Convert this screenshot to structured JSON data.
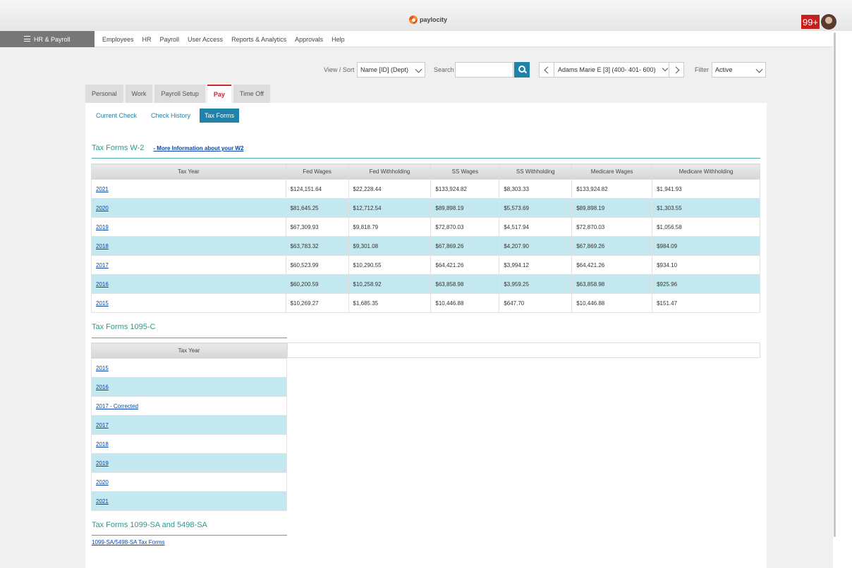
{
  "header": {
    "logo_text": "paylocity",
    "notification_count": "99+"
  },
  "nav": {
    "module_label": "HR & Payroll",
    "items": [
      "Employees",
      "HR",
      "Payroll",
      "User Access",
      "Reports & Analytics",
      "Approvals",
      "Help"
    ]
  },
  "controls": {
    "view_sort_label": "View / Sort",
    "view_sort_value": "Name [ID] (Dept)",
    "search_label": "Search",
    "search_value": "",
    "employee_value": "Adams Marie E [3] (400- 401- 600)",
    "filter_label": "Filter",
    "filter_value": "Active"
  },
  "tabs": [
    "Personal",
    "Work",
    "Payroll Setup",
    "Pay",
    "Time Off"
  ],
  "active_tab": "Pay",
  "subtabs": [
    "Current Check",
    "Check History",
    "Tax Forms"
  ],
  "active_subtab": "Tax Forms",
  "w2": {
    "title": "Tax Forms W-2",
    "more_link": "- More Information about your W2",
    "columns": [
      "Tax Year",
      "Fed Wages",
      "Fed Withholding",
      "SS Wages",
      "SS Withholding",
      "Medicare Wages",
      "Medicare Withholding"
    ],
    "rows": [
      [
        "2021",
        "$124,151.64",
        "$22,228.44",
        "$133,924.82",
        "$8,303.33",
        "$133,924.82",
        "$1,941.93"
      ],
      [
        "2020",
        "$81,645.25",
        "$12,712.54",
        "$89,898.19",
        "$5,573.69",
        "$89,898.19",
        "$1,303.55"
      ],
      [
        "2019",
        "$67,309.93",
        "$9,818.79",
        "$72,870.03",
        "$4,517.94",
        "$72,870.03",
        "$1,056.58"
      ],
      [
        "2018",
        "$63,783.32",
        "$9,301.08",
        "$67,869.26",
        "$4,207.90",
        "$67,869.26",
        "$984.09"
      ],
      [
        "2017",
        "$60,523.99",
        "$10,290.55",
        "$64,421.26",
        "$3,994.12",
        "$64,421.26",
        "$934.10"
      ],
      [
        "2016",
        "$60,200.59",
        "$10,258.92",
        "$63,858.98",
        "$3,959.25",
        "$63,858.98",
        "$925.96"
      ],
      [
        "2015",
        "$10,269.27",
        "$1,685.35",
        "$10,446.88",
        "$647.70",
        "$10,446.88",
        "$151.47"
      ]
    ]
  },
  "c1095": {
    "title": "Tax Forms 1095-C",
    "column": "Tax Year",
    "rows": [
      "2015",
      "2016",
      "2017 - Corrected",
      "2017",
      "2018",
      "2019",
      "2020",
      "2021"
    ]
  },
  "sa": {
    "title": "Tax Forms 1099-SA and 5498-SA",
    "link": "1099-SA/5498-SA Tax Forms"
  },
  "colors": {
    "accent": "#1f82a9",
    "section_title": "#2a9a8b",
    "active_tab": "#c8282e",
    "row_alt": "#c4e8ef",
    "badge": "#c5201e"
  }
}
